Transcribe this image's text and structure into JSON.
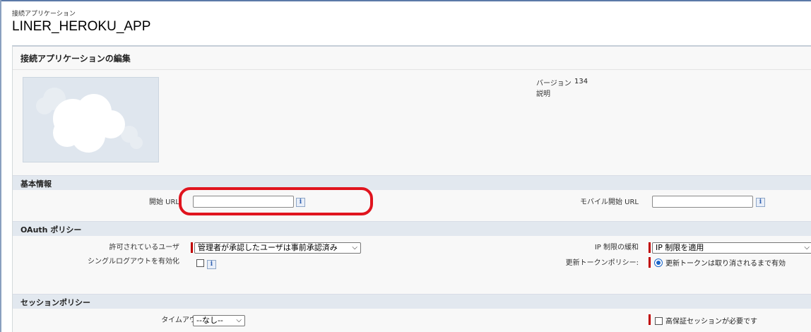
{
  "header": {
    "kicker": "接続アプリケーション",
    "title": "LINER_HEROKU_APP"
  },
  "panel": {
    "title": "接続アプリケーションの編集",
    "version_label": "バージョン",
    "version_value": "134",
    "description_label": "説明"
  },
  "sections": {
    "basic": "基本情報",
    "oauth": "OAuth ポリシー",
    "session": "セッションポリシー"
  },
  "basic_info": {
    "start_url_label": "開始 URL",
    "start_url_value": "",
    "mobile_start_url_label": "モバイル開始 URL",
    "mobile_start_url_value": ""
  },
  "oauth": {
    "permitted_users_label": "許可されているユーザ",
    "permitted_users_value": "管理者が承認したユーザは事前承認済み",
    "single_logout_label": "シングルログアウトを有効化",
    "single_logout_checked": false,
    "ip_relax_label": "IP 制限の緩和",
    "ip_relax_value": "IP 制限を適用",
    "refresh_token_label": "更新トークンポリシー:",
    "refresh_token_option": "更新トークンは取り消されるまで有効"
  },
  "session": {
    "timeout_label": "タイムアウト値",
    "timeout_value": "--なし--",
    "high_assurance_label": "高保証セッションが必要です",
    "high_assurance_checked": false
  },
  "icons": {
    "info": "info-icon",
    "chevron": "chevron-down-icon",
    "logo": "cloud-logo"
  },
  "colors": {
    "required": "#c00000",
    "highlight": "#e0141e",
    "section_bar": "#e2e8ef",
    "radio": "#1a64c8"
  }
}
